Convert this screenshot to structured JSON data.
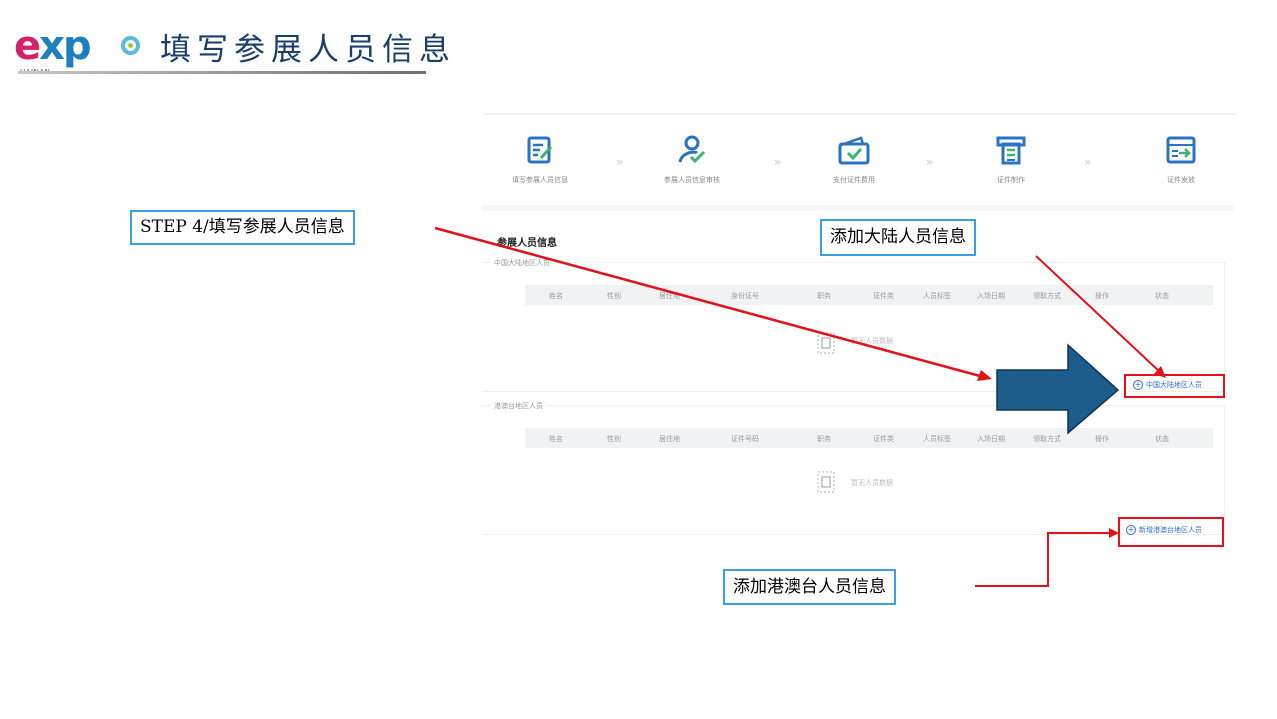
{
  "logo": {
    "e": "e",
    "x": "x",
    "p": "p",
    "sub": "HAINAN"
  },
  "page_title": "填写参展人员信息",
  "steps": [
    {
      "label": "填写参展人员信息",
      "icon": "edit-form-icon"
    },
    {
      "label": "参展人员信息审核",
      "icon": "user-check-icon"
    },
    {
      "label": "支付证件费用",
      "icon": "wallet-check-icon"
    },
    {
      "label": "证件制作",
      "icon": "printer-icon"
    },
    {
      "label": "证件发放",
      "icon": "card-export-icon"
    }
  ],
  "step_separator": "»",
  "section_title": "参展人员信息",
  "mainland": {
    "legend": "中国大陆地区人员",
    "columns": [
      "姓名",
      "性别",
      "居住地",
      "身份证号",
      "职务",
      "证件类",
      "人员标签",
      "入场日期",
      "领取方式",
      "操作",
      "状态"
    ],
    "empty_text": "暂无人员数据",
    "add_label": "中国大陆地区人员"
  },
  "hmt": {
    "legend": "港澳台地区人员",
    "columns": [
      "姓名",
      "性别",
      "居住地",
      "证件号码",
      "职务",
      "证件类",
      "人员标签",
      "入场日期",
      "领取方式",
      "操作",
      "状态"
    ],
    "empty_text": "暂无人员数据",
    "add_label": "新增港澳台地区人员"
  },
  "callouts": {
    "step": "STEP 4/填写参展人员信息",
    "mainland": "添加大陆人员信息",
    "hmt": "添加港澳台人员信息"
  },
  "colors": {
    "title": "#1a3d6e",
    "callout_border": "#3a9ee6",
    "annotation_red": "#e3111a",
    "big_arrow_fill": "#1e5c8c",
    "step_icon_blue": "#2a73c4",
    "step_icon_green": "#3cb371"
  }
}
